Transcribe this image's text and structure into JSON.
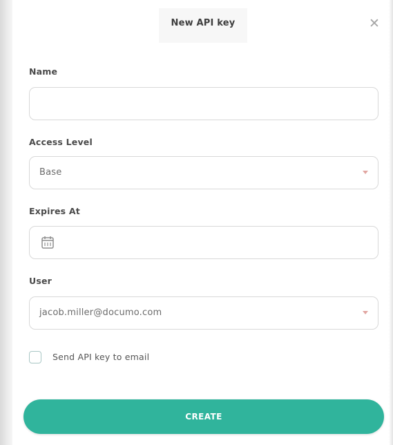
{
  "dialog": {
    "title": "New API key",
    "close_icon": "close-icon"
  },
  "form": {
    "name": {
      "label": "Name",
      "value": ""
    },
    "access_level": {
      "label": "Access Level",
      "value": "Base"
    },
    "expires_at": {
      "label": "Expires At",
      "icon": "calendar-icon",
      "value": ""
    },
    "user": {
      "label": "User",
      "value": "jacob.miller@documo.com"
    },
    "send_email": {
      "label": "Send API key to email",
      "checked": false
    }
  },
  "actions": {
    "create_label": "CREATE"
  },
  "colors": {
    "accent": "#30b49c",
    "dropdown_caret": "#e1a5a0",
    "checkbox_border": "#a8c6c4"
  }
}
